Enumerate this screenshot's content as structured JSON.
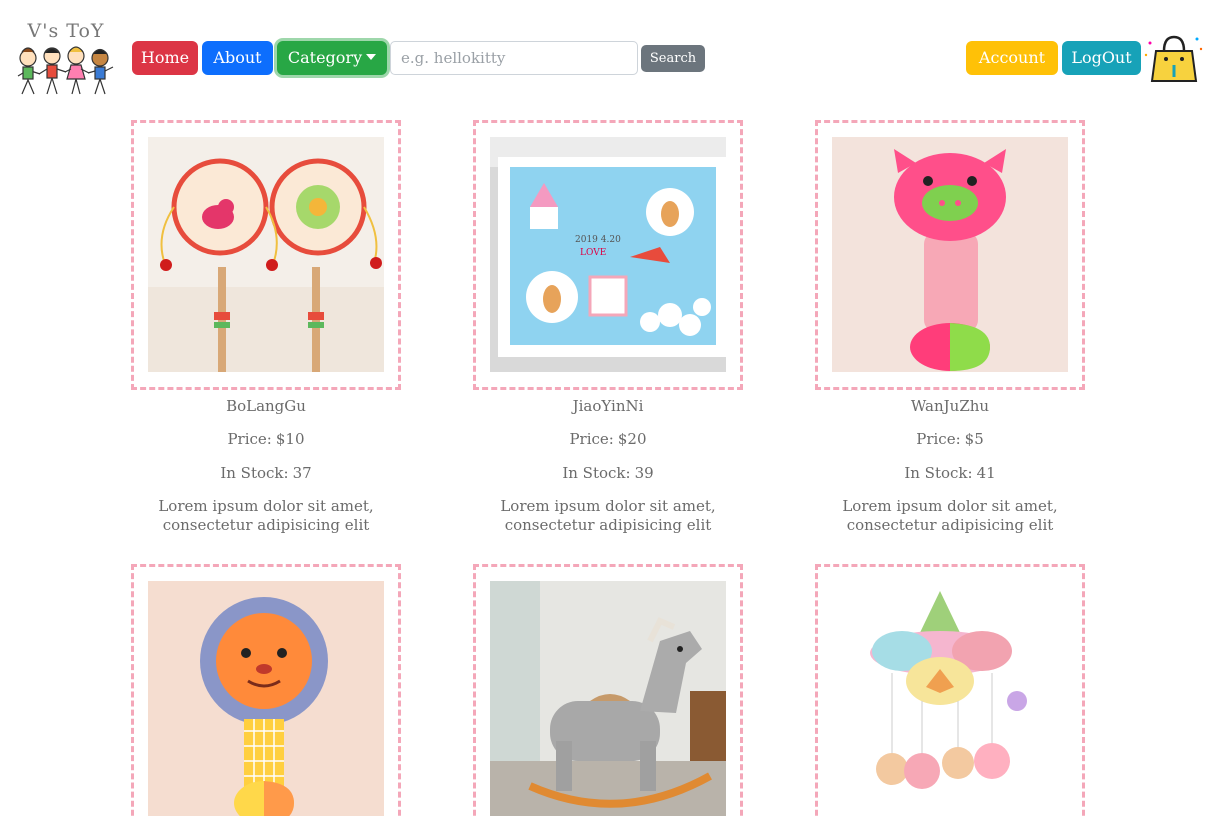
{
  "brand": {
    "name": "V's ToY"
  },
  "nav": {
    "home": "Home",
    "about": "About",
    "category": "Category",
    "search_placeholder": "e.g. hellokitty",
    "search_button": "Search",
    "account": "Account",
    "logout": "LogOut"
  },
  "product_labels": {
    "price": "Price:",
    "stock": "In Stock:"
  },
  "products": [
    {
      "name": "BoLangGu",
      "price": "$10",
      "stock": "37",
      "description": "Lorem ipsum dolor sit amet, consectetur adipisicing elit",
      "image": "rattle-drum"
    },
    {
      "name": "JiaoYinNi",
      "price": "$20",
      "stock": "39",
      "description": "Lorem ipsum dolor sit amet, consectetur adipisicing elit",
      "image": "footprint-frame"
    },
    {
      "name": "WanJuZhu",
      "price": "$5",
      "stock": "41",
      "description": "Lorem ipsum dolor sit amet, consectetur adipisicing elit",
      "image": "pink-pig-plush"
    },
    {
      "name": "",
      "price": "",
      "stock": "",
      "description": "",
      "image": "lion-rattle"
    },
    {
      "name": "",
      "price": "",
      "stock": "",
      "description": "",
      "image": "rocking-horse"
    },
    {
      "name": "",
      "price": "",
      "stock": "",
      "description": "",
      "image": "crib-mobile"
    }
  ],
  "colors": {
    "home": "#dc3545",
    "about": "#0d6efd",
    "category": "#28a745",
    "search": "#6c757d",
    "account": "#ffc107",
    "logout": "#17a2b8",
    "frame_border": "#f4a7b9"
  }
}
